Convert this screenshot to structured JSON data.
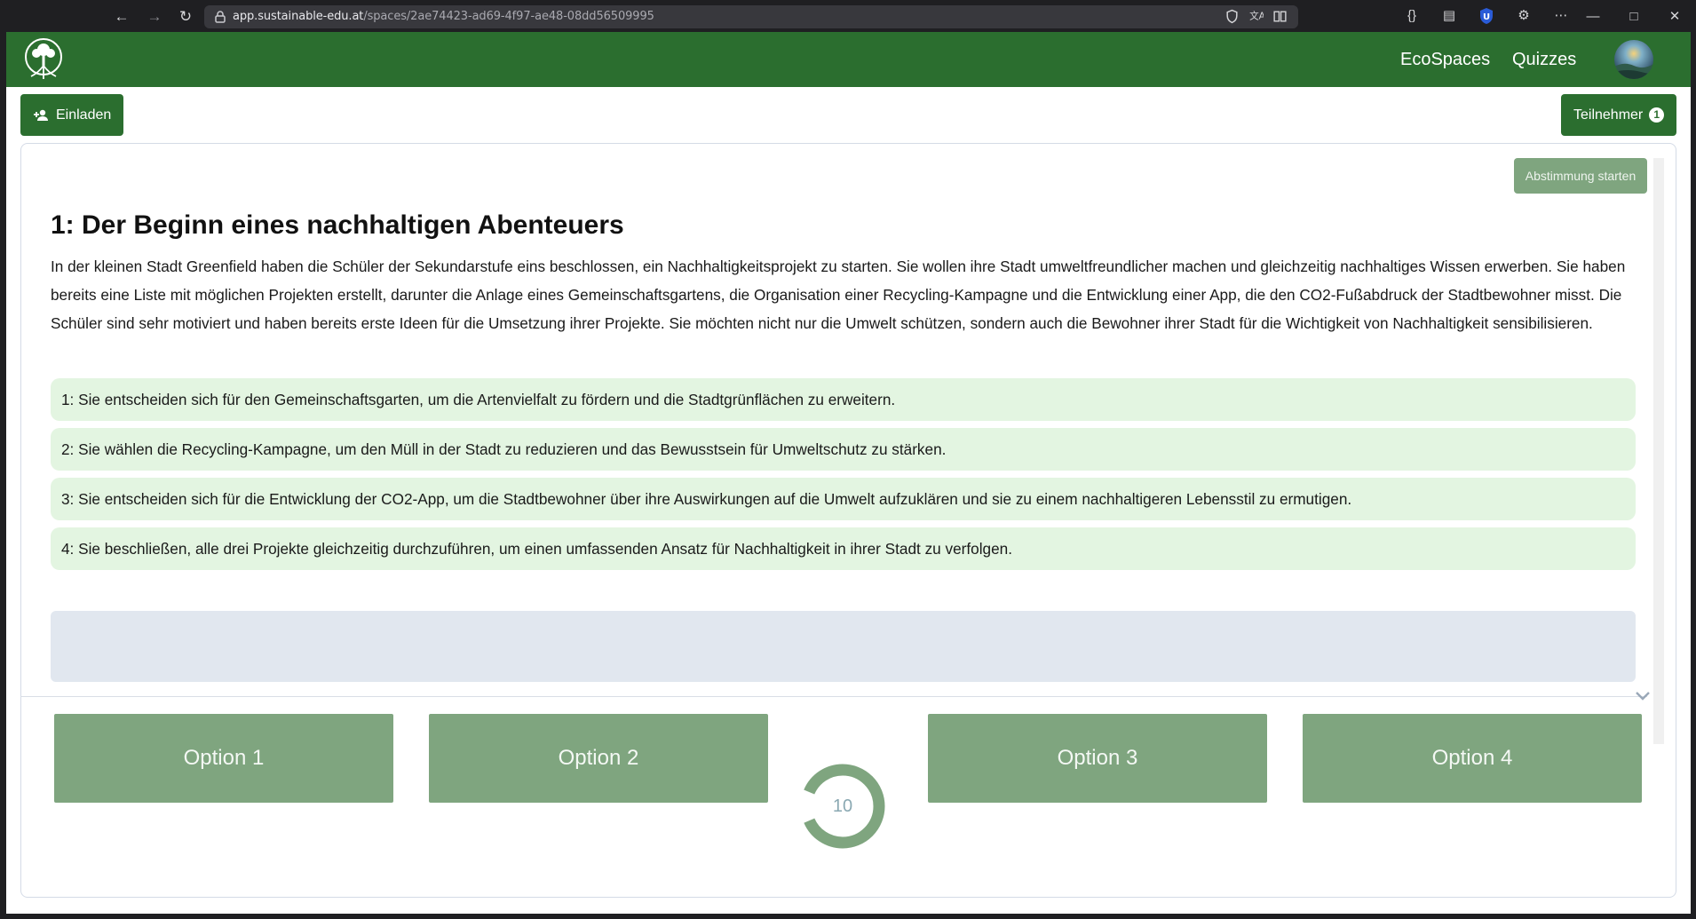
{
  "browser": {
    "url_host": "app.sustainable-edu.at",
    "url_path": "/spaces/2ae74423-ad69-4f97-ae48-08dd56509995"
  },
  "nav": {
    "links": [
      "EcoSpaces",
      "Quizzes"
    ]
  },
  "toolbar": {
    "invite_label": "Einladen",
    "participants_label": "Teilnehmer",
    "participants_count": "1",
    "start_vote_label": "Abstimmung starten"
  },
  "chapter": {
    "title": "1: Der Beginn eines nachhaltigen Abenteuers",
    "text": "In der kleinen Stadt Greenfield haben die Schüler der Sekundarstufe eins beschlossen, ein Nachhaltigkeitsprojekt zu starten. Sie wollen ihre Stadt umweltfreundlicher machen und gleichzeitig nachhaltiges Wissen erwerben. Sie haben bereits eine Liste mit möglichen Projekten erstellt, darunter die Anlage eines Gemeinschaftsgartens, die Organisation einer Recycling-Kampagne und die Entwicklung einer App, die den CO2-Fußabdruck der Stadtbewohner misst. Die Schüler sind sehr motiviert und haben bereits erste Ideen für die Umsetzung ihrer Projekte. Sie möchten nicht nur die Umwelt schützen, sondern auch die Bewohner ihrer Stadt für die Wichtigkeit von Nachhaltigkeit sensibilisieren.",
    "options": [
      "1: Sie entscheiden sich für den Gemeinschaftsgarten, um die Artenvielfalt zu fördern und die Stadtgrünflächen zu erweitern.",
      "2: Sie wählen die Recycling-Kampagne, um den Müll in der Stadt zu reduzieren und das Bewusstsein für Umweltschutz zu stärken.",
      "3: Sie entscheiden sich für die Entwicklung der CO2-App, um die Stadtbewohner über ihre Auswirkungen auf die Umwelt aufzuklären und sie zu einem nachhaltigeren Lebensstil zu ermutigen.",
      "4: Sie beschließen, alle drei Projekte gleichzeitig durchzuführen, um einen umfassenden Ansatz für Nachhaltigkeit in ihrer Stadt zu verfolgen."
    ]
  },
  "answers": [
    "Option 1",
    "Option 2",
    "Option 3",
    "Option 4"
  ],
  "timer": {
    "value": "10"
  },
  "colors": {
    "brand_green": "#2b6e2f",
    "option_bg": "#e3f5e1",
    "answer_btn": "#7fa57f",
    "timer_ring": "#7fa57f"
  }
}
